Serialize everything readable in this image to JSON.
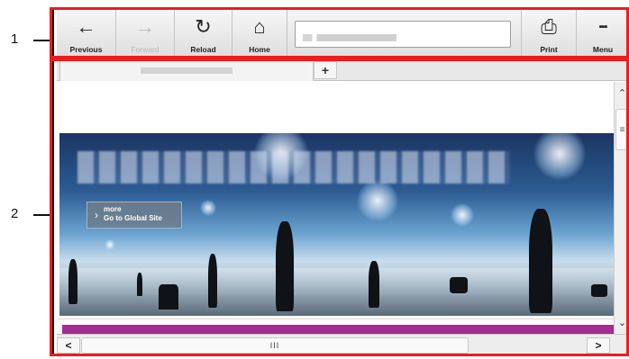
{
  "callouts": [
    {
      "number": "1"
    },
    {
      "number": "2"
    }
  ],
  "toolbar": {
    "buttons": [
      {
        "label": "Previous",
        "icon": "arrow-left-icon",
        "glyph": "←"
      },
      {
        "label": "Forward",
        "icon": "arrow-right-icon",
        "glyph": "→"
      },
      {
        "label": "Reload",
        "icon": "reload-icon",
        "glyph": "↻"
      },
      {
        "label": "Home",
        "icon": "home-icon",
        "glyph": "⌂"
      },
      {
        "label": "Print",
        "icon": "print-icon",
        "glyph": "⎙"
      },
      {
        "label": "Menu",
        "icon": "menu-icon",
        "glyph": "▪▪▪"
      }
    ]
  },
  "tabs": {
    "add_label": "+"
  },
  "hero": {
    "more_label": "more",
    "global_site_label": "Go to Global Site",
    "chevron": "›"
  },
  "scrollbars": {
    "up": "⌃",
    "down": "⌄",
    "v_grip": "≡",
    "left": "<",
    "right": ">",
    "h_grip": "III"
  },
  "colors": {
    "highlight": "#ee1c1c",
    "accent_bar": "#a42c92"
  }
}
